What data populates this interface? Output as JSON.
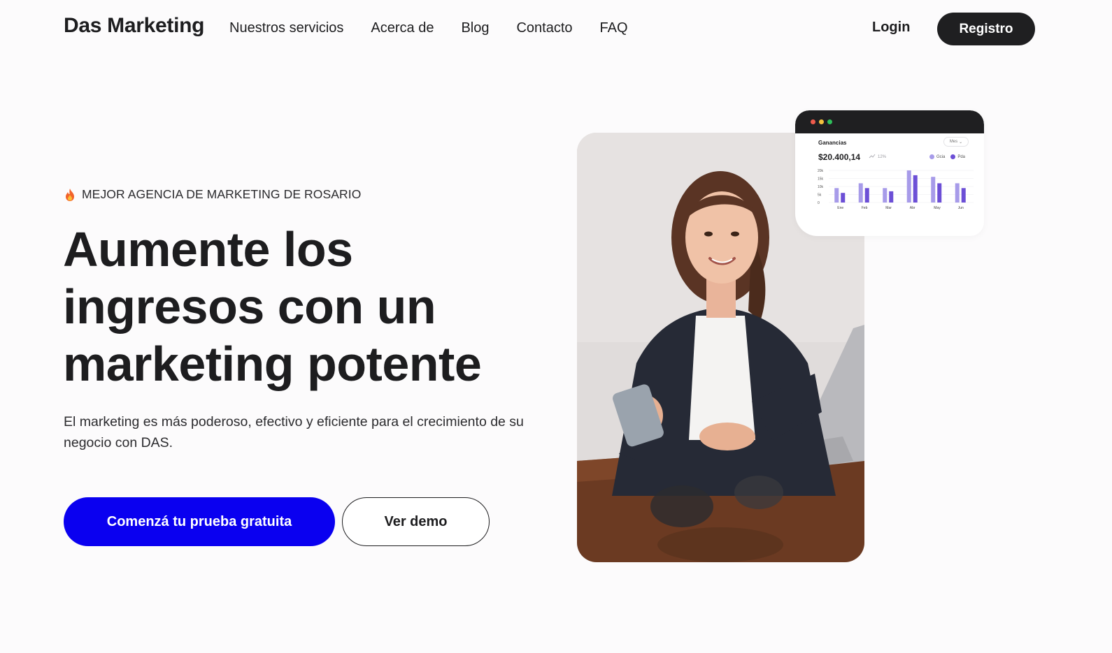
{
  "nav": {
    "brand": "Das Marketing",
    "links": [
      "Nuestros servicios",
      "Acerca de",
      "Blog",
      "Contacto",
      "FAQ"
    ],
    "login": "Login",
    "register": "Registro"
  },
  "hero": {
    "eyebrow": "MEJOR AGENCIA DE MARKETING DE ROSARIO",
    "headline": [
      "Aumente los",
      "ingresos con un",
      "marketing potente"
    ],
    "subtext": "El marketing es más poderoso, efectivo y eficiente para el crecimiento de su negocio con DAS.",
    "cta_primary": "Comenzá tu prueba gratuita",
    "cta_secondary": "Ver demo"
  },
  "dashboard": {
    "title": "Ganancias",
    "select": "Mes",
    "value": "$20.400,14",
    "trend": "12%",
    "legend": [
      {
        "label": "Gcia",
        "color": "#a79be9"
      },
      {
        "label": "Pda",
        "color": "#6c4fd6"
      }
    ],
    "window_dots": [
      "#ef5b4c",
      "#f4c23d",
      "#2fbf5b"
    ]
  },
  "chart_data": {
    "type": "bar",
    "categories": [
      "Ene",
      "Feb",
      "Mar",
      "Abr",
      "May",
      "Jun"
    ],
    "yticks": [
      "20k",
      "15k",
      "10k",
      "5k",
      "0"
    ],
    "ylim": [
      0,
      20
    ],
    "series": [
      {
        "name": "Gcia",
        "values": [
          9,
          12,
          9,
          20,
          16,
          12
        ]
      },
      {
        "name": "Pda",
        "values": [
          6,
          9,
          7,
          17,
          12,
          9
        ]
      }
    ]
  },
  "colors": {
    "primary": "#0a00f0",
    "dark": "#1f1f21",
    "text": "#1d1d1f"
  }
}
